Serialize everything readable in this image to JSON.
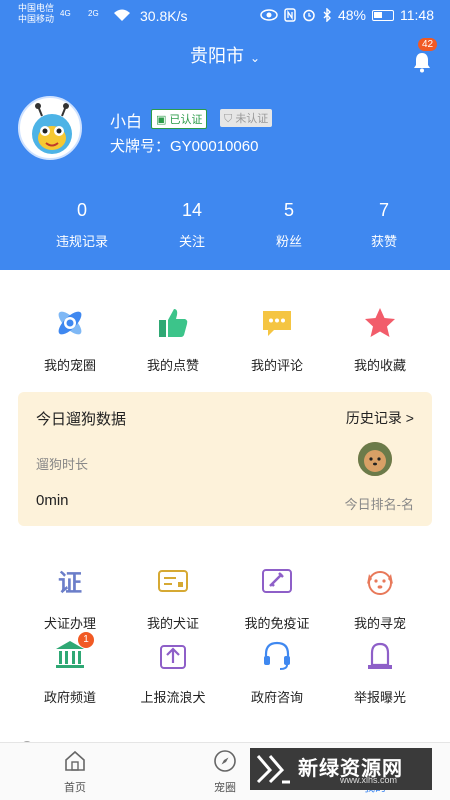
{
  "status_bar": {
    "carrier1": "中国电信",
    "carrier2": "中国移动",
    "sig1": "4G",
    "sig2": "2G",
    "speed": "30.8K/s",
    "battery": "48%",
    "time": "11:48"
  },
  "header": {
    "city": "贵阳市",
    "notification_count": "42",
    "username": "小白",
    "verified_label": "已认证",
    "unverified_label": "未认证",
    "plate": "犬牌号：GY00010060",
    "stats": [
      {
        "num": "0",
        "label": "违规记录"
      },
      {
        "num": "14",
        "label": "关注"
      },
      {
        "num": "5",
        "label": "粉丝"
      },
      {
        "num": "7",
        "label": "获赞"
      }
    ]
  },
  "quick_menu": [
    {
      "label": "我的宠圈",
      "icon": "pet-circle-icon",
      "color": "#3f88f0"
    },
    {
      "label": "我的点赞",
      "icon": "thumbs-up-icon",
      "color": "#3cc48a"
    },
    {
      "label": "我的评论",
      "icon": "comment-icon",
      "color": "#f5c542"
    },
    {
      "label": "我的收藏",
      "icon": "star-icon",
      "color": "#f25c6a"
    }
  ],
  "walk_card": {
    "title": "今日遛狗数据",
    "history": "历史记录 >",
    "duration_label": "遛狗时长",
    "duration_value": "0min",
    "rank": "今日排名-名"
  },
  "services": [
    {
      "label": "犬证办理",
      "icon": "certificate-icon"
    },
    {
      "label": "我的犬证",
      "icon": "dog-license-icon"
    },
    {
      "label": "我的免疫证",
      "icon": "vaccine-icon"
    },
    {
      "label": "我的寻宠",
      "icon": "dog-face-icon"
    },
    {
      "label": "政府频道",
      "icon": "government-icon",
      "badge": "1"
    },
    {
      "label": "上报流浪犬",
      "icon": "upload-icon"
    },
    {
      "label": "政府咨询",
      "icon": "headset-icon"
    },
    {
      "label": "举报曝光",
      "icon": "alarm-icon"
    }
  ],
  "tabbar": [
    {
      "label": "首页",
      "icon": "home-icon"
    },
    {
      "label": "宠圈",
      "icon": "compass-icon"
    },
    {
      "label": "我的",
      "icon": "profile-icon"
    }
  ],
  "watermark": {
    "text": "新绿资源网",
    "url": "www.xlhs.com"
  }
}
